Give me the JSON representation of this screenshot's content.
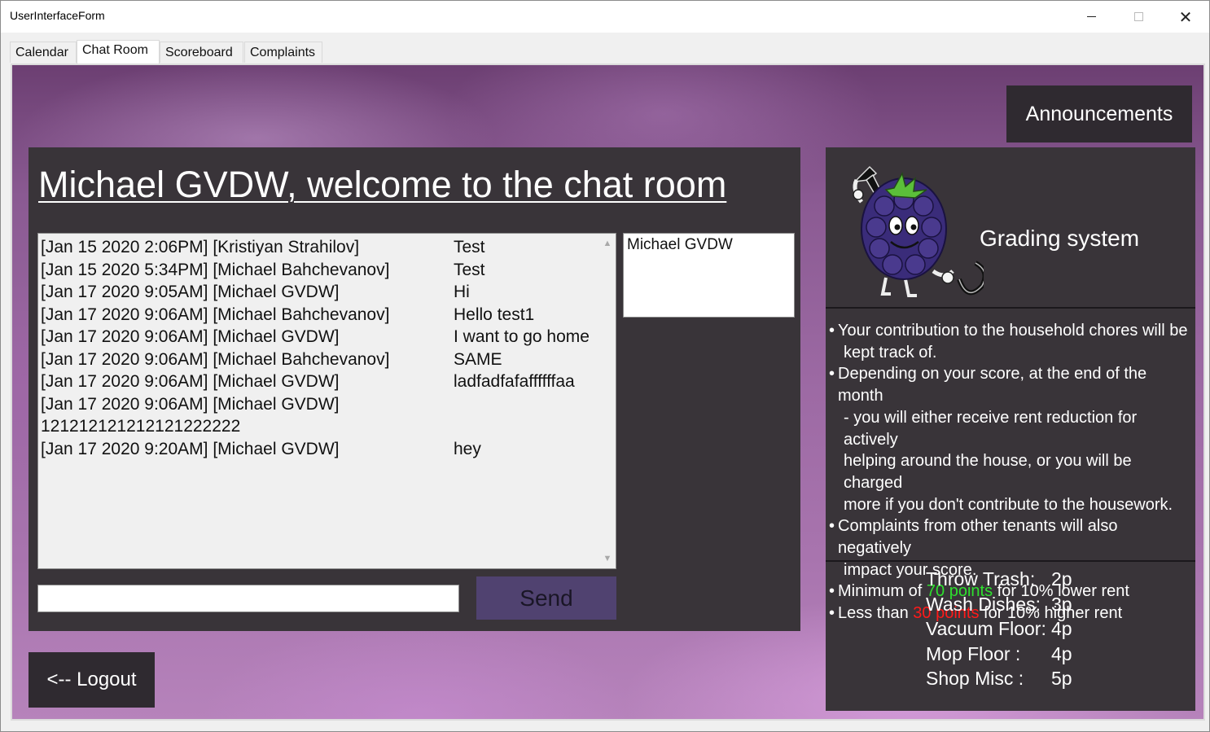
{
  "window": {
    "title": "UserInterfaceForm"
  },
  "tabs": [
    {
      "label": "Calendar",
      "active": false
    },
    {
      "label": "Chat Room",
      "active": true
    },
    {
      "label": "Scoreboard",
      "active": false
    },
    {
      "label": "Complaints",
      "active": false
    }
  ],
  "announcements_label": "Announcements",
  "chat": {
    "welcome": "Michael GVDW, welcome to the chat room",
    "messages": [
      {
        "meta": "[Jan 15 2020  2:06PM] [Kristiyan Strahilov]",
        "text": "Test"
      },
      {
        "meta": "[Jan 15 2020  5:34PM] [Michael Bahchevanov]",
        "text": "Test"
      },
      {
        "meta": "[Jan 17 2020  9:05AM] [Michael GVDW]",
        "text": "Hi"
      },
      {
        "meta": "[Jan 17 2020  9:06AM] [Michael Bahchevanov]",
        "text": "Hello test1"
      },
      {
        "meta": "[Jan 17 2020  9:06AM] [Michael GVDW]",
        "text": "I want to go home"
      },
      {
        "meta": "[Jan 17 2020  9:06AM] [Michael Bahchevanov]",
        "text": "SAME"
      },
      {
        "meta": "[Jan 17 2020  9:06AM] [Michael GVDW]",
        "text": "ladfadfafaffffffaa"
      },
      {
        "meta": "[Jan 17 2020  9:06AM] [Michael GVDW]",
        "text": ""
      },
      {
        "meta": "121212121212121222222",
        "text": ""
      },
      {
        "meta": "[Jan 17 2020  9:20AM] [Michael GVDW]",
        "text": "hey"
      }
    ],
    "online_users": [
      "Michael GVDW"
    ],
    "input_value": "",
    "send_label": "Send"
  },
  "logout_label": "<--   Logout",
  "grading": {
    "title": "Grading system",
    "rules": {
      "r1_a": "Your contribution to the household  chores will be",
      "r1_b": "kept track of.",
      "r2_a": "Depending on your score, at the end of the month",
      "r2_b": "- you will either receive rent reduction for actively",
      "r2_c": "helping around the house, or you will be charged",
      "r2_d": "more if you don't contribute to the housework.",
      "r3_a": "Complaints from other tenants will also negatively",
      "r3_b": "impact your score.",
      "r4_pre": "Minimum of ",
      "r4_hl": "70 points",
      "r4_post": " for 10% lower rent",
      "r5_pre": "Less than ",
      "r5_hl": "30 points",
      "r5_post": " for 10% higher rent"
    },
    "bullet": "•",
    "points": [
      {
        "task": "Throw Trash:",
        "value": "2p"
      },
      {
        "task": "Wash Dishes:",
        "value": "3p"
      },
      {
        "task": "Vacuum Floor:",
        "value": "4p"
      },
      {
        "task": "Mop Floor :",
        "value": "4p"
      },
      {
        "task": "Shop Misc :",
        "value": "5p"
      }
    ]
  },
  "colors": {
    "panel_dark": "#393439",
    "button_dark": "#2f2a30",
    "send_button": "#504270",
    "highlight_green": "#2ee02e",
    "highlight_red": "#ff1a1a"
  }
}
